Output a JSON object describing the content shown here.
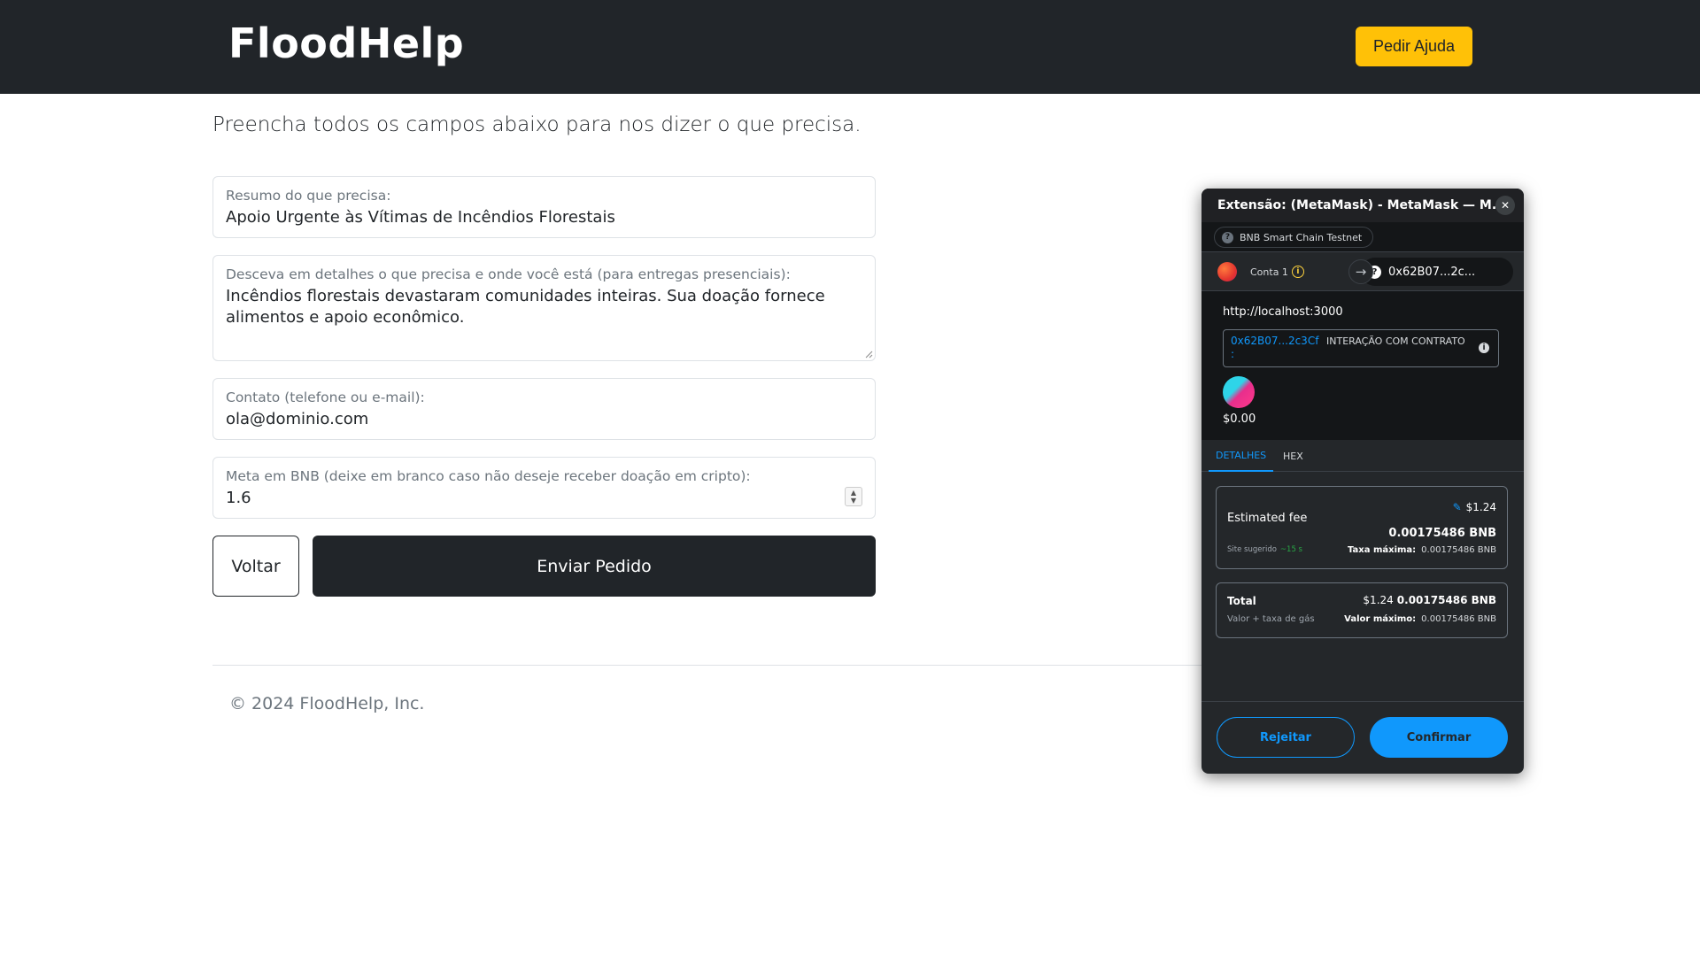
{
  "header": {
    "brand": "FloodHelp",
    "help_button": "Pedir Ajuda"
  },
  "form": {
    "lead": "Preencha todos os campos abaixo para nos dizer o que precisa.",
    "summary": {
      "label": "Resumo do que precisa:",
      "value": "Apoio Urgente às Vítimas de Incêndios Florestais"
    },
    "details": {
      "label": "Desceva em detalhes o que precisa e onde você está (para entregas presenciais):",
      "value": "Incêndios florestais devastaram comunidades inteiras. Sua doação fornece alimentos e apoio econômico."
    },
    "contact": {
      "label": "Contato (telefone ou e-mail):",
      "value": "ola@dominio.com"
    },
    "goal": {
      "label": "Meta em BNB (deixe em branco caso não deseje receber doação em cripto):",
      "value": "1.6"
    },
    "back_button": "Voltar",
    "submit_button": "Enviar Pedido"
  },
  "footer": {
    "copyright": "© 2024 FloodHelp, Inc."
  },
  "metamask": {
    "window_title": "Extensão: (MetaMask) - MetaMask — M...",
    "network": "BNB Smart Chain Testnet",
    "account": "Conta 1",
    "destination": "0x62B07...2c...",
    "origin": "http://localhost:3000",
    "contract_address": "0x62B07...2c3Cf",
    "contract_colon": ":",
    "contract_kind": "INTERAÇÃO COM CONTRATO",
    "amount": "$0.00",
    "tabs": [
      "DETALHES",
      "HEX"
    ],
    "fee": {
      "label": "Estimated fee",
      "usd": "$1.24",
      "bnb": "0.00175486 BNB",
      "site_suggested": "Site sugerido",
      "time": "~15 s",
      "max_label": "Taxa máxima:",
      "max_value": "0.00175486 BNB"
    },
    "total": {
      "label": "Total",
      "usd": "$1.24",
      "bnb": "0.00175486 BNB",
      "sub": "Valor + taxa de gás",
      "max_label": "Valor máximo:",
      "max_value": "0.00175486 BNB"
    },
    "reject_button": "Rejeitar",
    "confirm_button": "Confirmar",
    "colors": {
      "accent": "#1098fc",
      "background": "#24272a",
      "warning": "#ffd33d"
    }
  },
  "icons": {
    "close": "close-icon",
    "network_question": "question-icon",
    "info": "info-icon",
    "arrow": "arrow-right-icon",
    "pencil": "pencil-icon"
  }
}
